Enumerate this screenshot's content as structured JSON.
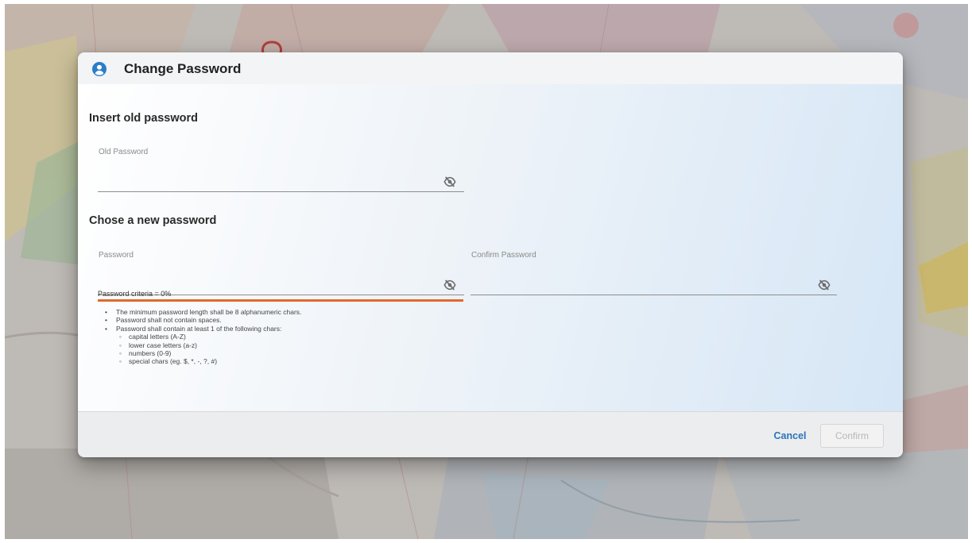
{
  "dialog": {
    "title": "Change Password",
    "icon": "account-circle-icon",
    "accent_color": "#2a7dc9"
  },
  "old_password_section": {
    "title": "Insert old password",
    "field": {
      "label": "Old Password",
      "value": "",
      "toggle_icon": "visibility-off-icon"
    }
  },
  "new_password_section": {
    "title": "Chose a new password",
    "password": {
      "label": "Password",
      "value": "",
      "toggle_icon": "visibility-off-icon"
    },
    "confirm": {
      "label": "Confirm Password",
      "value": "",
      "toggle_icon": "visibility-off-icon"
    },
    "criteria": {
      "label": "Password criteria = 0%",
      "bar_color": "#e06a2c",
      "percent": 0,
      "rules": [
        "The minimum password length shall be 8 alphanumeric chars.",
        "Password shall not contain spaces.",
        "Password shall contain at least 1 of the following chars:"
      ],
      "sub_rules": [
        "capital letters (A-Z)",
        "lower case letters (a-z)",
        "numbers (0-9)",
        "special chars (eg. $, *, -, ?, #)"
      ]
    }
  },
  "footer": {
    "cancel_label": "Cancel",
    "confirm_label": "Confirm",
    "cancel_color": "#2c74b8"
  }
}
